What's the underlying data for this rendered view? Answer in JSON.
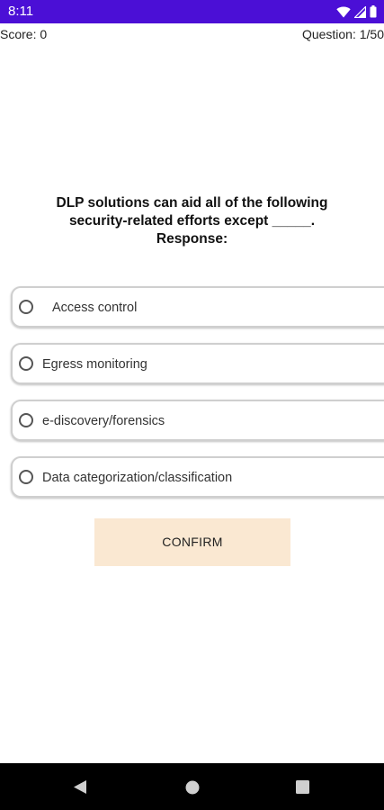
{
  "status_bar": {
    "time": "8:11",
    "color": "#4b0fd6",
    "icons": [
      "wifi-icon",
      "signal-icon",
      "battery-icon"
    ]
  },
  "header": {
    "score_label": "Score: 0",
    "question_counter": "Question: 1/50"
  },
  "question": {
    "lines": [
      "DLP solutions can aid all of the following",
      "security-related efforts except _____.",
      "Response:"
    ]
  },
  "options": [
    {
      "label": "Access control",
      "selected": false
    },
    {
      "label": "Egress monitoring",
      "selected": false
    },
    {
      "label": "e-discovery/forensics",
      "selected": false
    },
    {
      "label": "Data categorization/classification",
      "selected": false
    }
  ],
  "confirm": {
    "label": "CONFIRM",
    "color": "#fae8d2"
  },
  "nav_bar": {
    "icons": [
      "back-icon",
      "home-icon",
      "recents-icon"
    ]
  }
}
